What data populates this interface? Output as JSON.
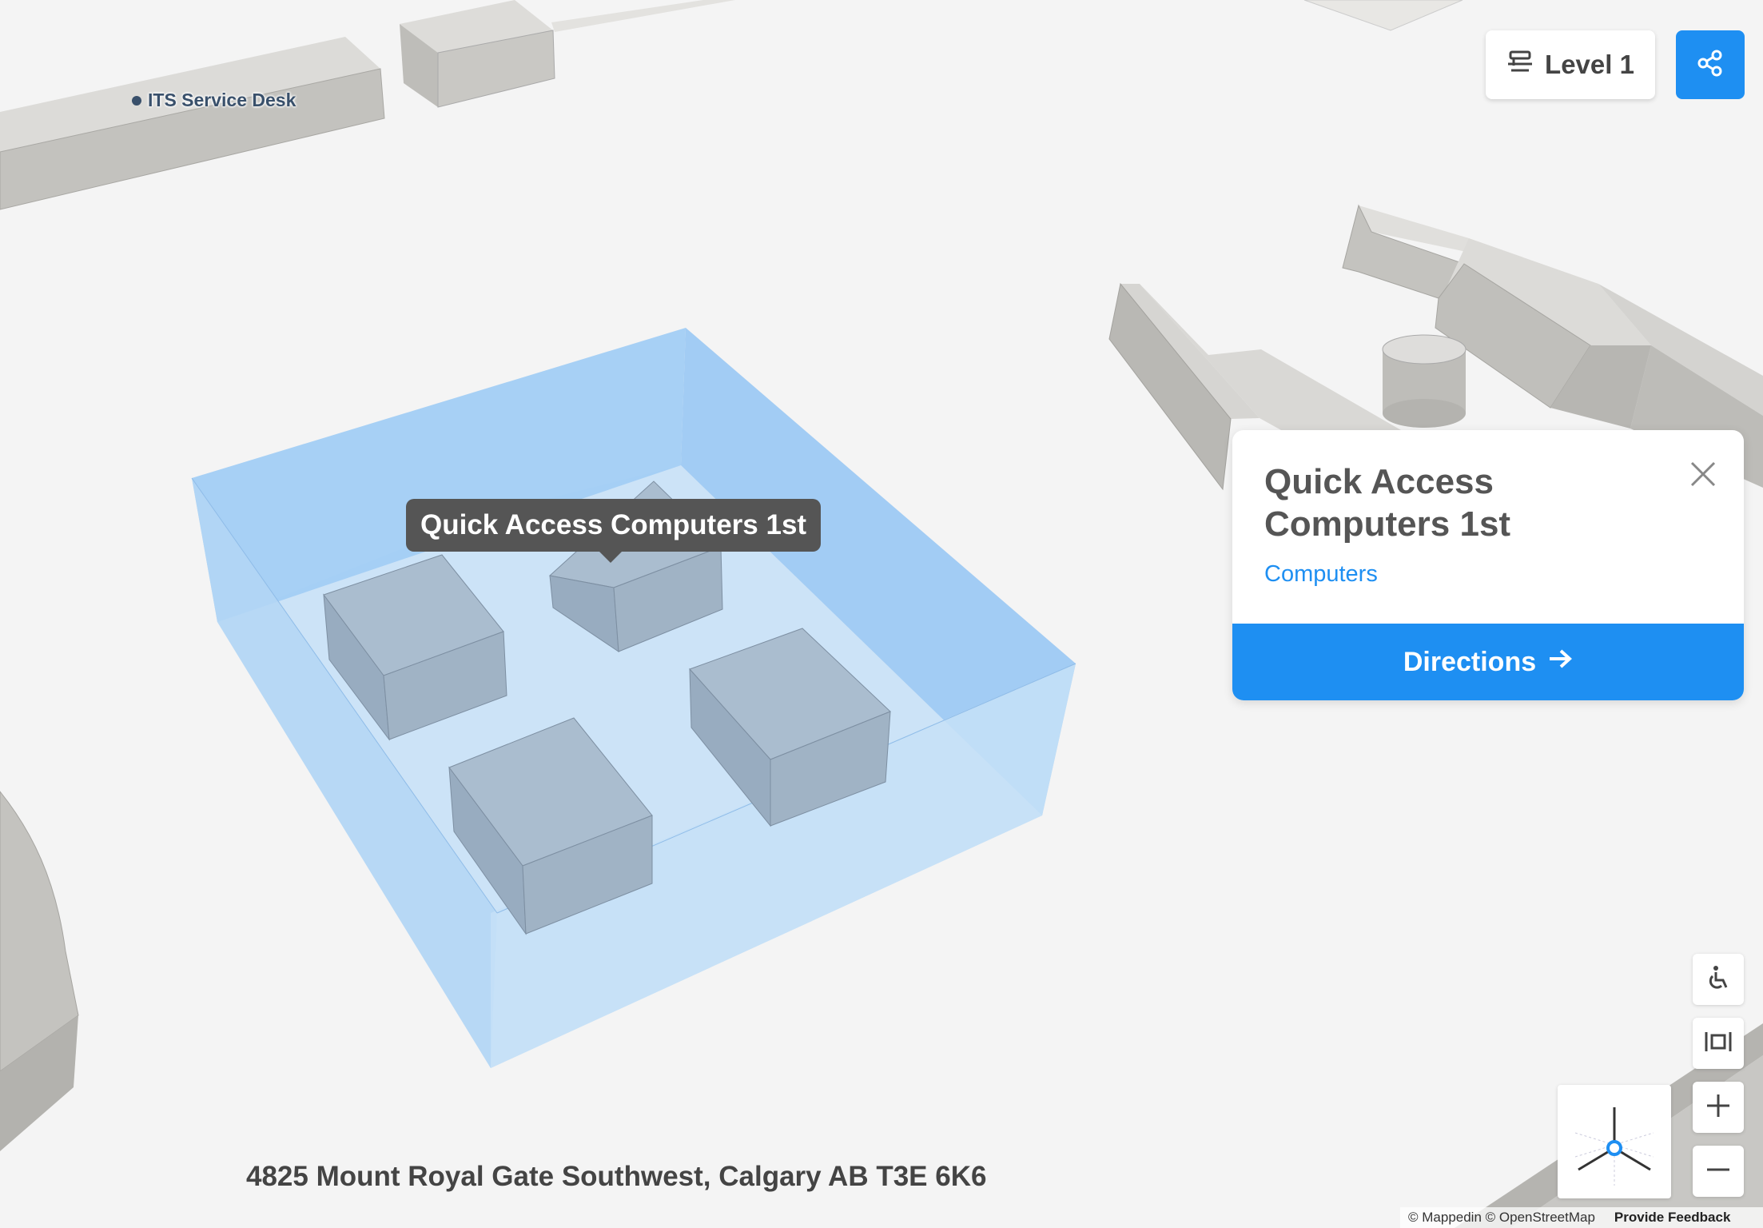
{
  "map": {
    "label_its": "ITS Service Desk",
    "tooltip": "Quick Access Computers 1st",
    "address": "4825 Mount Royal Gate Southwest, Calgary AB T3E 6K6"
  },
  "level_selector": {
    "label": "Level 1",
    "icon": "floors-icon"
  },
  "share": {
    "icon": "share-icon"
  },
  "card": {
    "title": "Quick Access Computers 1st",
    "category": "Computers",
    "directions_label": "Directions",
    "close_icon": "close-icon",
    "arrow_icon": "arrow-right-icon"
  },
  "controls": {
    "accessibility_icon": "wheelchair-icon",
    "view_icon": "fit-view-icon",
    "zoom_in_icon": "plus-icon",
    "zoom_out_icon": "minus-icon",
    "compass_icon": "compass-icon"
  },
  "attribution": {
    "text": "© Mappedin © OpenStreetMap",
    "feedback": "Provide Feedback"
  },
  "colors": {
    "accent": "#1e8ff2",
    "highlight_room": "#a7cff5",
    "building": "#c8c7c4",
    "tooltip_bg": "#555555",
    "background": "#f4f4f4"
  }
}
